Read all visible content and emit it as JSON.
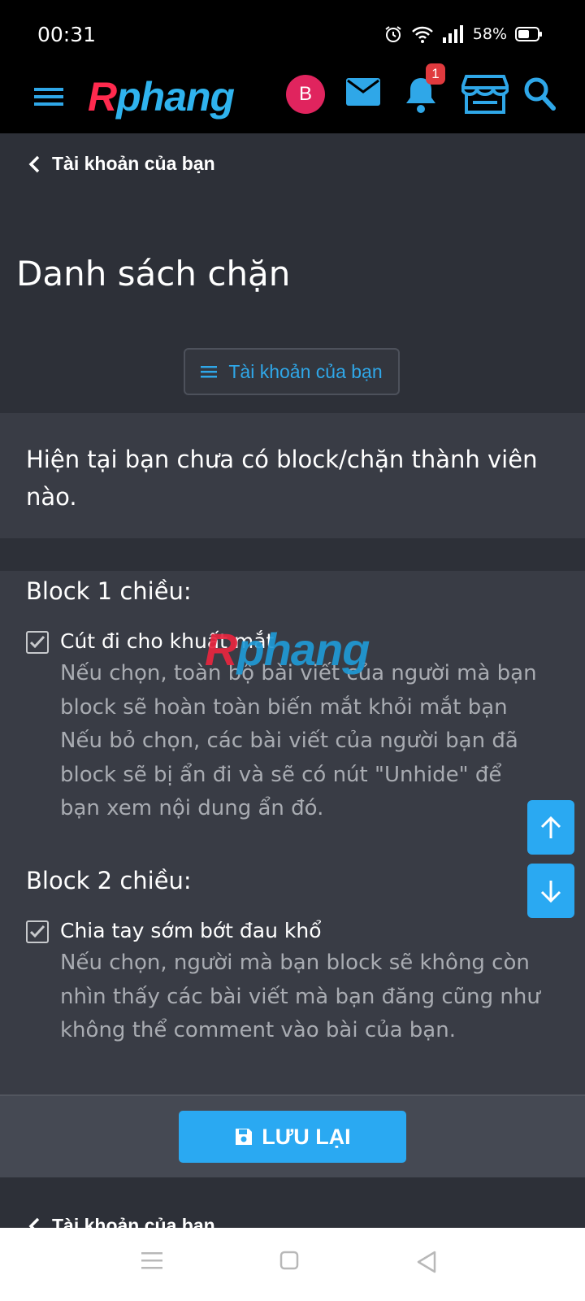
{
  "status": {
    "time": "00:31",
    "battery": "58%",
    "icons": [
      "alarm-icon",
      "wifi-icon",
      "signal-icon",
      "battery-icon"
    ]
  },
  "header": {
    "logo_part1": "R",
    "logo_part2": "phang",
    "avatar_letter": "B",
    "notification_count": "1",
    "icons": [
      "menu-icon",
      "mail-icon",
      "bell-icon",
      "store-icon",
      "search-icon"
    ]
  },
  "breadcrumb": {
    "label": "Tài khoản của bạn"
  },
  "page": {
    "title": "Danh sách chặn",
    "menu_button": "Tài khoản của bạn"
  },
  "notice": {
    "text": "Hiện tại bạn chưa có block/chặn thành viên nào."
  },
  "options": {
    "one_way": {
      "heading": "Block 1 chiều:",
      "label": "Cút đi cho khuất mắt",
      "checked": true,
      "description": "Nếu chọn, toàn bộ bài viết của người mà bạn block sẽ hoàn toàn biến mắt khỏi mắt bạn Nếu bỏ chọn, các bài viết của người bạn đã block sẽ bị ẩn đi và sẽ có nút \"Unhide\" để bạn xem nội dung ẩn đó."
    },
    "two_way": {
      "heading": "Block 2 chiều:",
      "label": "Chia tay sớm bớt đau khổ",
      "checked": true,
      "description": "Nếu chọn, người mà bạn block sẽ không còn nhìn thấy các bài viết mà bạn đăng cũng như không thể comment vào bài của bạn."
    }
  },
  "watermark": {
    "part1": "R",
    "part2": "phang"
  },
  "save": {
    "label": "LƯU LẠI"
  },
  "footer_breadcrumb": {
    "label": "Tài khoản của bạn"
  },
  "colors": {
    "accent": "#2aa9f2",
    "background": "#2d3038",
    "panel": "#393c45",
    "logo_red": "#ff2a4e",
    "logo_blue": "#2fb3ee"
  }
}
